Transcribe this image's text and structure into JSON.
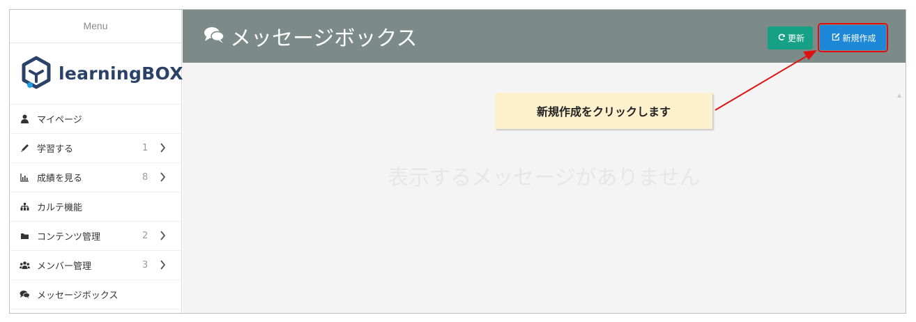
{
  "sidebar": {
    "menu_title": "Menu",
    "logo_text": "learningBOX",
    "items": [
      {
        "label": "マイページ",
        "icon": "user-icon",
        "count": "",
        "chevron": false
      },
      {
        "label": "学習する",
        "icon": "pencil-icon",
        "count": "1",
        "chevron": true
      },
      {
        "label": "成績を見る",
        "icon": "bar-chart-icon",
        "count": "8",
        "chevron": true
      },
      {
        "label": "カルテ機能",
        "icon": "sitemap-icon",
        "count": "",
        "chevron": false
      },
      {
        "label": "コンテンツ管理",
        "icon": "folder-icon",
        "count": "2",
        "chevron": true
      },
      {
        "label": "メンバー管理",
        "icon": "users-icon",
        "count": "3",
        "chevron": true
      },
      {
        "label": "メッセージボックス",
        "icon": "comments-icon",
        "count": "",
        "chevron": false
      }
    ]
  },
  "header": {
    "title": "メッセージボックス",
    "title_icon": "comments-icon",
    "refresh_label": "更新",
    "refresh_icon": "refresh-icon",
    "new_label": "新規作成",
    "new_icon": "edit-icon"
  },
  "main": {
    "empty_message": "表示するメッセージがありません"
  },
  "annotation": {
    "callout_text": "新規作成をクリックします"
  },
  "colors": {
    "header_bg": "#7d8b88",
    "refresh_bg": "#16a085",
    "new_bg": "#1e88d8",
    "highlight": "#e01010",
    "callout_bg": "#fdf0cd",
    "logo": "#2b4268"
  }
}
